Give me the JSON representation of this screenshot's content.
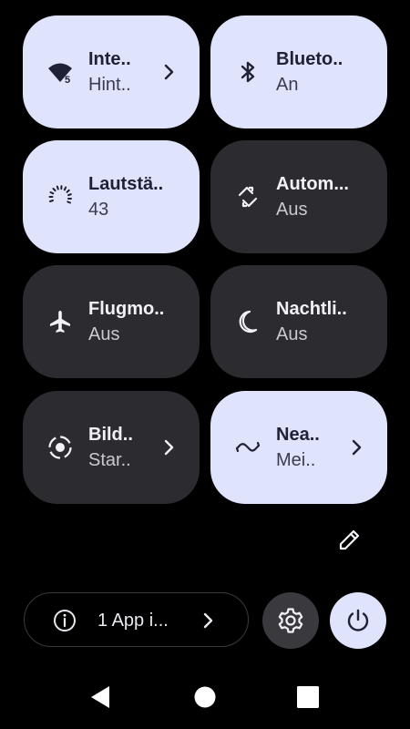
{
  "tiles": [
    {
      "id": "internet",
      "label": "Inte..",
      "state": "Hint..",
      "icon": "wifi-icon",
      "active": true,
      "has_chevron": true,
      "icon_badge": "5"
    },
    {
      "id": "bluetooth",
      "label": "Blueto..",
      "state": "An",
      "icon": "bluetooth-icon",
      "active": true,
      "has_chevron": false
    },
    {
      "id": "volume",
      "label": "Lautstä..",
      "state": "43",
      "icon": "volume-dial-icon",
      "active": true,
      "has_chevron": false
    },
    {
      "id": "autorotate",
      "label": "Autom...",
      "state": "Aus",
      "icon": "rotate-icon",
      "active": false,
      "has_chevron": false
    },
    {
      "id": "airplane",
      "label": "Flugmo..",
      "state": "Aus",
      "icon": "airplane-icon",
      "active": false,
      "has_chevron": false
    },
    {
      "id": "nightlight",
      "label": "Nachtli..",
      "state": "Aus",
      "icon": "moon-icon",
      "active": false,
      "has_chevron": false
    },
    {
      "id": "screenrecord",
      "label": "Bild..",
      "state": "Star..",
      "icon": "screen-record-icon",
      "active": false,
      "has_chevron": true
    },
    {
      "id": "nearby",
      "label": "Nea..",
      "state": "Mei..",
      "icon": "nearby-share-icon",
      "active": true,
      "has_chevron": true
    }
  ],
  "footer": {
    "active_apps_label": "1 App i...",
    "edit_icon": "pencil-icon",
    "settings_icon": "gear-icon",
    "power_icon": "power-icon"
  },
  "nav": {
    "back_icon": "back-triangle-icon",
    "home_icon": "home-circle-icon",
    "recents_icon": "recents-square-icon"
  },
  "colors": {
    "background": "#000000",
    "tile_on": "#dfe3fb",
    "tile_off": "#2c2c30",
    "text_on": "#1f2236",
    "text_off": "#f2f2f6"
  }
}
